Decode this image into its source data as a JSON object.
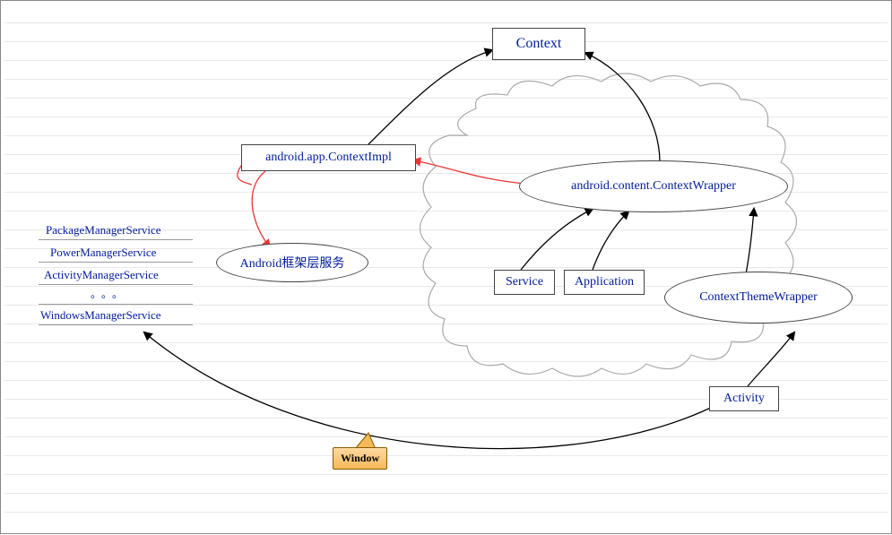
{
  "chart_data": {
    "type": "diagram",
    "title": "",
    "nodes": [
      {
        "id": "context",
        "label": "Context",
        "shape": "rect"
      },
      {
        "id": "contextimpl",
        "label": "android.app.ContextImpl",
        "shape": "rect"
      },
      {
        "id": "framework",
        "label": "Android框架层服务",
        "shape": "ellipse"
      },
      {
        "id": "contextwrapper",
        "label": "android.content.ContextWrapper",
        "shape": "ellipse"
      },
      {
        "id": "service",
        "label": "Service",
        "shape": "rect"
      },
      {
        "id": "application",
        "label": "Application",
        "shape": "rect"
      },
      {
        "id": "themewrapper",
        "label": "ContextThemeWrapper",
        "shape": "ellipse"
      },
      {
        "id": "activity",
        "label": "Activity",
        "shape": "rect"
      },
      {
        "id": "window",
        "label": "Window",
        "shape": "note"
      },
      {
        "id": "cloud",
        "label": "",
        "shape": "cloud"
      }
    ],
    "edges": [
      {
        "from": "contextimpl",
        "to": "context",
        "color": "black"
      },
      {
        "from": "contextwrapper",
        "to": "context",
        "color": "black"
      },
      {
        "from": "contextwrapper",
        "to": "contextimpl",
        "color": "red"
      },
      {
        "from": "contextimpl",
        "to": "framework",
        "color": "red"
      },
      {
        "from": "service",
        "to": "contextwrapper",
        "color": "black"
      },
      {
        "from": "application",
        "to": "contextwrapper",
        "color": "black"
      },
      {
        "from": "themewrapper",
        "to": "contextwrapper",
        "color": "black"
      },
      {
        "from": "activity",
        "to": "themewrapper",
        "color": "black"
      },
      {
        "from": "activity",
        "to": "windowsmanagerservice",
        "color": "black"
      },
      {
        "from": "window",
        "to": "activity-edge",
        "color": "callout"
      }
    ],
    "services_list": [
      "PackageManagerService",
      "PowerManagerService",
      "ActivityManagerService",
      "WindowsManagerService"
    ]
  },
  "nodes": {
    "context": "Context",
    "contextimpl": "android.app.ContextImpl",
    "framework": "Android框架层服务",
    "contextwrapper": "android.content.ContextWrapper",
    "service": "Service",
    "application": "Application",
    "themewrapper": "ContextThemeWrapper",
    "activity": "Activity",
    "window": "Window"
  },
  "services": {
    "s0": "PackageManagerService",
    "s1": "PowerManagerService",
    "s2": "ActivityManagerService",
    "s3": "WindowsManagerService",
    "dots": "。。。"
  }
}
